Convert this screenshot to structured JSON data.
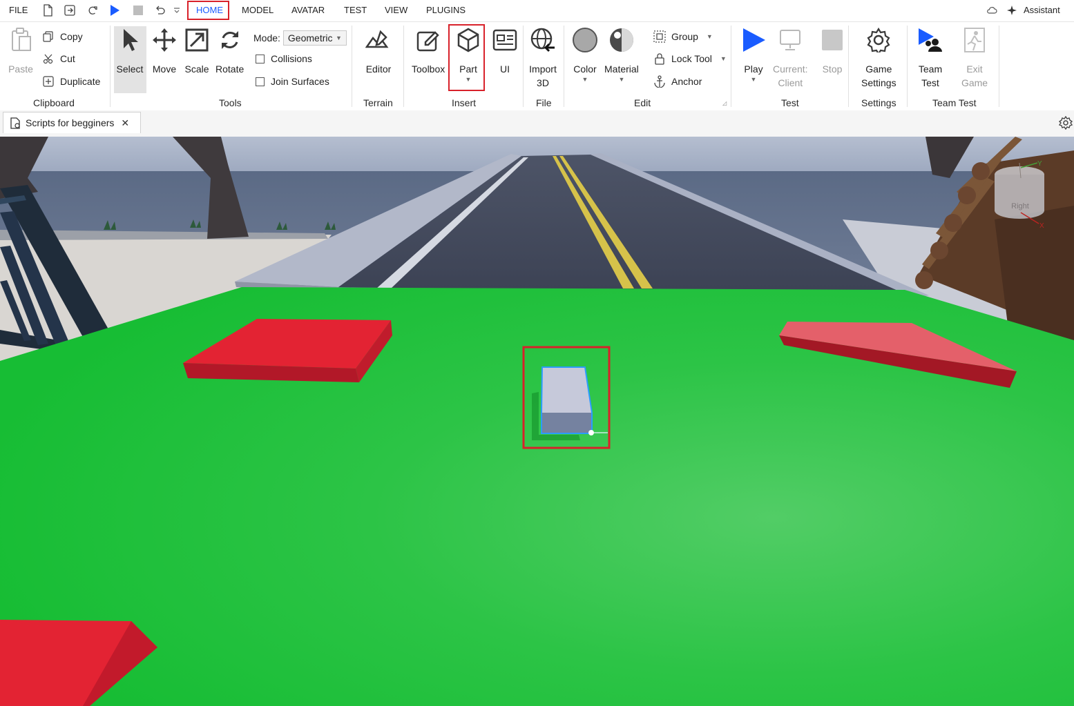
{
  "menu": {
    "file": "FILE",
    "tabs": [
      "HOME",
      "MODEL",
      "AVATAR",
      "TEST",
      "VIEW",
      "PLUGINS"
    ],
    "active_tab": "HOME",
    "assistant": "Assistant"
  },
  "clipboard": {
    "paste": "Paste",
    "copy": "Copy",
    "cut": "Cut",
    "duplicate": "Duplicate",
    "label": "Clipboard"
  },
  "tools": {
    "select": "Select",
    "move": "Move",
    "scale": "Scale",
    "rotate": "Rotate",
    "mode_label": "Mode:",
    "mode_value": "Geometric",
    "collisions": "Collisions",
    "join_surfaces": "Join Surfaces",
    "label": "Tools"
  },
  "terrain": {
    "editor": "Editor",
    "label": "Terrain"
  },
  "insert": {
    "toolbox": "Toolbox",
    "part": "Part",
    "ui": "UI",
    "label": "Insert"
  },
  "file_group": {
    "import_line1": "Import",
    "import_line2": "3D",
    "label": "File"
  },
  "edit": {
    "color": "Color",
    "material": "Material",
    "group": "Group",
    "lock_tool": "Lock Tool",
    "anchor": "Anchor",
    "label": "Edit"
  },
  "test": {
    "play": "Play",
    "current_line1": "Current:",
    "current_line2": "Client",
    "stop": "Stop",
    "label": "Test"
  },
  "settings": {
    "game_line1": "Game",
    "game_line2": "Settings",
    "label": "Settings"
  },
  "team_test": {
    "team_line1": "Team",
    "team_line2": "Test",
    "exit_line1": "Exit",
    "exit_line2": "Game",
    "label": "Team Test"
  },
  "document_tab": {
    "title": "Scripts for begginers"
  },
  "viewport": {
    "view_cube_face": "Right",
    "axis_y": "Y",
    "axis_x": "X"
  },
  "colors": {
    "highlight": "#d8212a",
    "accent_blue": "#1a5cff",
    "baseplate_green": "#1fc43c",
    "pad_red": "#e02030",
    "part_gray": "#c4c8d8"
  }
}
